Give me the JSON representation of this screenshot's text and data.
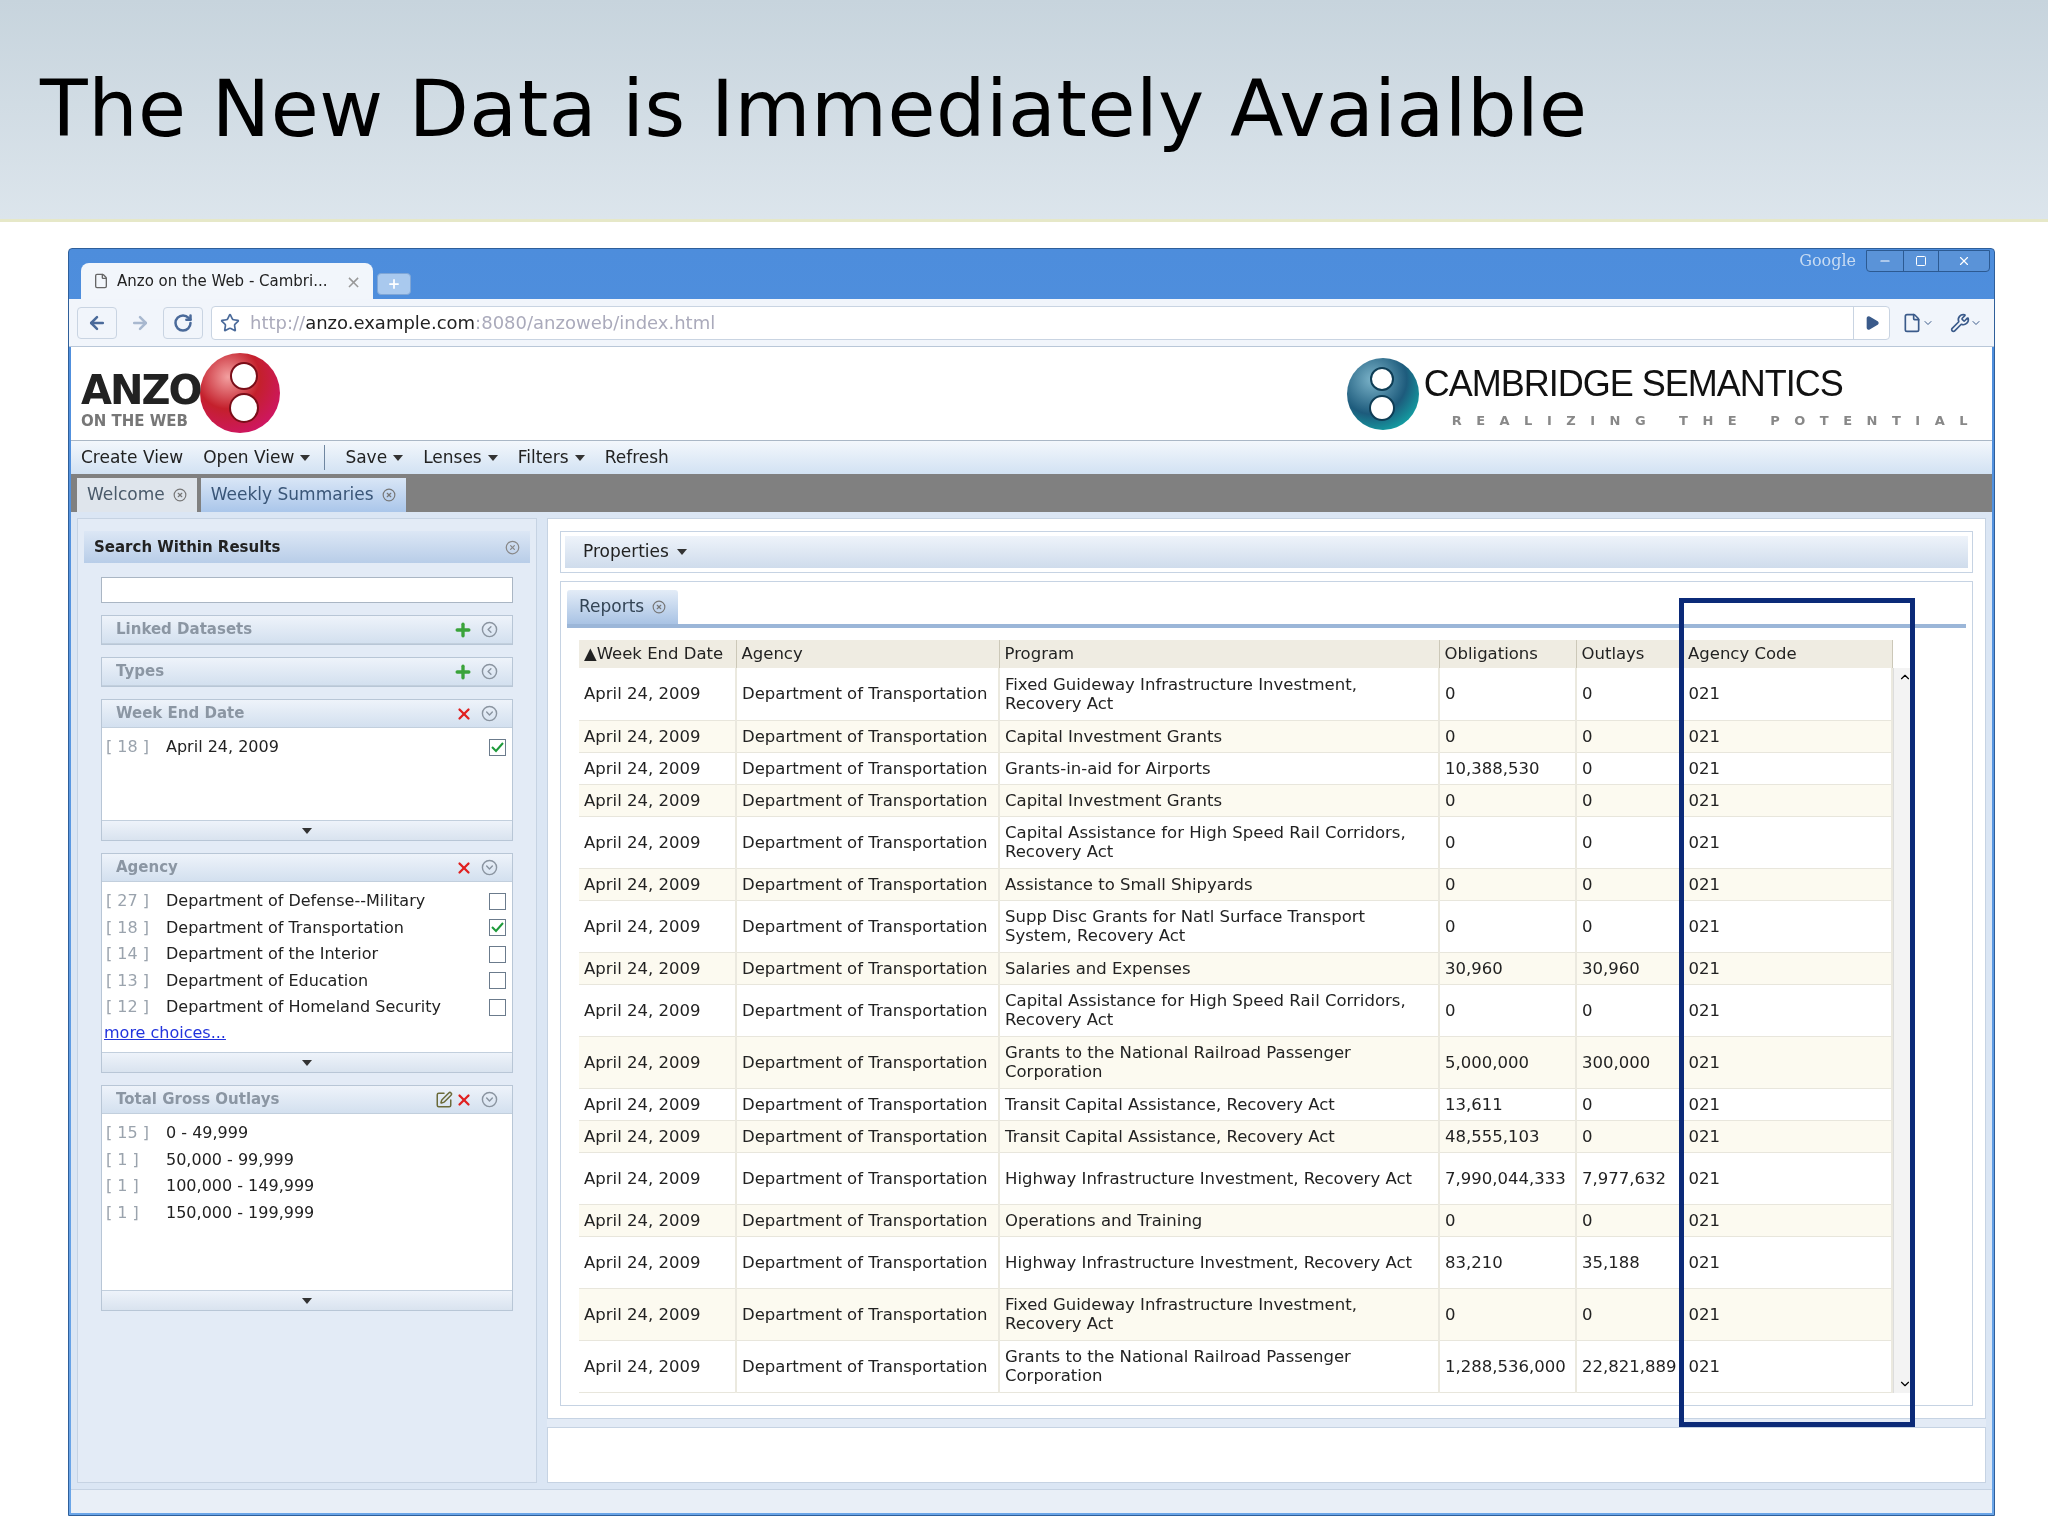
{
  "slide_title": "The New Data is Immediately Avaialble",
  "browser": {
    "tab_title": "Anzo on the Web - Cambri...",
    "tab_close": "×",
    "search_brand": "Google",
    "url_scheme": "http://",
    "url_host": "anzo.example.com",
    "url_path": ":8080/anzoweb/index.html"
  },
  "app_logo": {
    "word": "ANZO",
    "tagline": "ON THE WEB"
  },
  "company_logo": {
    "name": "CAMBRIDGE SEMANTICS",
    "tagline": "REALIZING THE POTENTIAL"
  },
  "menu": [
    {
      "label": "Create View",
      "dropdown": false,
      "divider_after": false
    },
    {
      "label": "Open View",
      "dropdown": true,
      "divider_after": true
    },
    {
      "label": "Save",
      "dropdown": true,
      "divider_after": false
    },
    {
      "label": "Lenses",
      "dropdown": true,
      "divider_after": false
    },
    {
      "label": "Filters",
      "dropdown": true,
      "divider_after": false
    },
    {
      "label": "Refresh",
      "dropdown": false,
      "divider_after": false
    }
  ],
  "tabs": [
    {
      "label": "Welcome",
      "selected": false
    },
    {
      "label": "Weekly Summaries",
      "selected": true
    }
  ],
  "search_panel": {
    "title": "Search Within Results"
  },
  "facets": [
    {
      "title": "Linked Datasets",
      "expanded": false,
      "kind": "add"
    },
    {
      "title": "Types",
      "expanded": false,
      "kind": "add"
    },
    {
      "title": "Week End Date",
      "expanded": true,
      "kind": "checklist",
      "items": [
        {
          "count": "[ 18 ]",
          "label": "April 24, 2009",
          "checked": true
        }
      ]
    },
    {
      "title": "Agency",
      "expanded": true,
      "kind": "checklist",
      "more": "more choices...",
      "items": [
        {
          "count": "[ 27 ]",
          "label": "Department of Defense--Military",
          "checked": false
        },
        {
          "count": "[ 18 ]",
          "label": "Department of Transportation",
          "checked": true
        },
        {
          "count": "[ 14 ]",
          "label": "Department of the Interior",
          "checked": false
        },
        {
          "count": "[ 13 ]",
          "label": "Department of Education",
          "checked": false
        },
        {
          "count": "[ 12 ]",
          "label": "Department of Homeland Security",
          "checked": false
        }
      ]
    },
    {
      "title": "Total Gross Outlays",
      "expanded": true,
      "kind": "range",
      "items": [
        {
          "count": "[ 15 ]",
          "label": "0 - 49,999"
        },
        {
          "count": "[ 1 ]",
          "label": "50,000 - 99,999"
        },
        {
          "count": "[ 1 ]",
          "label": "100,000 - 149,999"
        },
        {
          "count": "[ 1 ]",
          "label": "150,000 - 199,999"
        }
      ]
    }
  ],
  "properties": {
    "label": "Properties"
  },
  "report_tab": {
    "label": "Reports",
    "selected": true
  },
  "table": {
    "columns": [
      "▲Week End Date",
      "Agency",
      "Program",
      "Obligations",
      "Outlays",
      "Agency Code"
    ],
    "rows": [
      [
        "April 24, 2009",
        "Department of Transportation",
        "Fixed Guideway Infrastructure Investment, Recovery Act",
        "0",
        "0",
        "021"
      ],
      [
        "April 24, 2009",
        "Department of Transportation",
        "Capital Investment Grants",
        "0",
        "0",
        "021"
      ],
      [
        "April 24, 2009",
        "Department of Transportation",
        "Grants-in-aid for Airports",
        "10,388,530",
        "0",
        "021"
      ],
      [
        "April 24, 2009",
        "Department of Transportation",
        "Capital Investment Grants",
        "0",
        "0",
        "021"
      ],
      [
        "April 24, 2009",
        "Department of Transportation",
        "Capital Assistance for High Speed Rail Corridors, Recovery Act",
        "0",
        "0",
        "021"
      ],
      [
        "April 24, 2009",
        "Department of Transportation",
        "Assistance to Small Shipyards",
        "0",
        "0",
        "021"
      ],
      [
        "April 24, 2009",
        "Department of Transportation",
        "Supp Disc Grants for Natl Surface Transport System, Recovery Act",
        "0",
        "0",
        "021"
      ],
      [
        "April 24, 2009",
        "Department of Transportation",
        "Salaries and Expenses",
        "30,960",
        "30,960",
        "021"
      ],
      [
        "April 24, 2009",
        "Department of Transportation",
        "Capital Assistance for High Speed Rail Corridors, Recovery Act",
        "0",
        "0",
        "021"
      ],
      [
        "April 24, 2009",
        "Department of Transportation",
        "Grants to the National Railroad Passenger Corporation",
        "5,000,000",
        "300,000",
        "021"
      ],
      [
        "April 24, 2009",
        "Department of Transportation",
        "Transit Capital Assistance, Recovery Act",
        "13,611",
        "0",
        "021"
      ],
      [
        "April 24, 2009",
        "Department of Transportation",
        "Transit Capital Assistance, Recovery Act",
        "48,555,103",
        "0",
        "021"
      ],
      [
        "April 24, 2009",
        "Department of Transportation",
        "Highway Infrastructure Investment, Recovery Act",
        "7,990,044,333",
        "7,977,632",
        "021"
      ],
      [
        "April 24, 2009",
        "Department of Transportation",
        "Operations and Training",
        "0",
        "0",
        "021"
      ],
      [
        "April 24, 2009",
        "Department of Transportation",
        "Highway Infrastructure Investment, Recovery Act",
        "83,210",
        "35,188",
        "021"
      ],
      [
        "April 24, 2009",
        "Department of Transportation",
        "Fixed Guideway Infrastructure Investment, Recovery Act",
        "0",
        "0",
        "021"
      ],
      [
        "April 24, 2009",
        "Department of Transportation",
        "Grants to the National Railroad Passenger Corporation",
        "1,288,536,000",
        "22,821,889",
        "021"
      ]
    ]
  }
}
